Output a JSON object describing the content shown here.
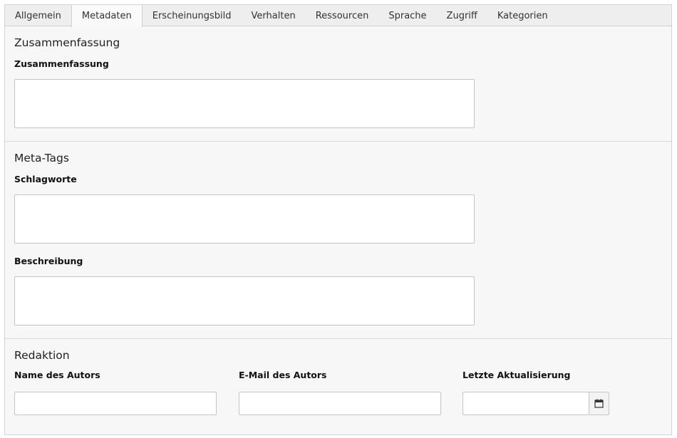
{
  "tabs": [
    {
      "label": "Allgemein",
      "active": false
    },
    {
      "label": "Metadaten",
      "active": true
    },
    {
      "label": "Erscheinungsbild",
      "active": false
    },
    {
      "label": "Verhalten",
      "active": false
    },
    {
      "label": "Ressourcen",
      "active": false
    },
    {
      "label": "Sprache",
      "active": false
    },
    {
      "label": "Zugriff",
      "active": false
    },
    {
      "label": "Kategorien",
      "active": false
    }
  ],
  "sections": {
    "summary": {
      "title": "Zusammenfassung",
      "field_label": "Zusammenfassung",
      "value": ""
    },
    "meta": {
      "title": "Meta-Tags",
      "keywords_label": "Schlagworte",
      "keywords_value": "",
      "description_label": "Beschreibung",
      "description_value": ""
    },
    "editorial": {
      "title": "Redaktion",
      "author_name_label": "Name des Autors",
      "author_name_value": "",
      "author_email_label": "E-Mail des Autors",
      "author_email_value": "",
      "last_update_label": "Letzte Aktualisierung",
      "last_update_value": "",
      "calendar_icon": "calendar-icon"
    }
  }
}
